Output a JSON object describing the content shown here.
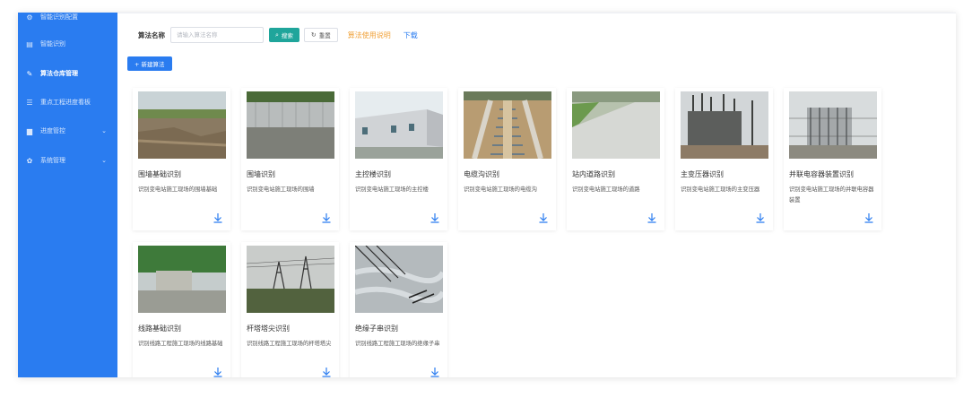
{
  "sidebar": {
    "items": [
      {
        "label": "智能识别配置",
        "icon": "settings-icon"
      },
      {
        "label": "智能识别",
        "icon": "document-icon"
      },
      {
        "label": "算法仓库管理",
        "icon": "edit-icon"
      },
      {
        "label": "重点工程进度看板",
        "icon": "list-icon"
      },
      {
        "label": "进度管控",
        "icon": "folder-icon"
      },
      {
        "label": "系统管理",
        "icon": "gear-icon"
      }
    ]
  },
  "toolbar": {
    "name_label": "算法名称",
    "search_placeholder": "请输入算法名称",
    "search_value": "",
    "search_button": "搜索",
    "reset_button": "重置",
    "guide_link": "算法使用说明",
    "download_link": "下载"
  },
  "new_button": "+ 新建算法",
  "cards": [
    {
      "title": "围墙基础识别",
      "desc": "识别变电站施工现场的围墙基础"
    },
    {
      "title": "围墙识别",
      "desc": "识别变电站施工现场的围墙"
    },
    {
      "title": "主控楼识别",
      "desc": "识别变电站施工现场的主控楼"
    },
    {
      "title": "电缆沟识别",
      "desc": "识别变电站施工现场的电缆沟"
    },
    {
      "title": "站内道路识别",
      "desc": "识别变电站施工现场的道路"
    },
    {
      "title": "主变压器识别",
      "desc": "识别变电站施工现场的主变压器"
    },
    {
      "title": "并联电容器装置识别",
      "desc": "识别变电站施工现场的并联电容器装置"
    },
    {
      "title": "线路基础识别",
      "desc": "识别线路工程施工现场的线路基础"
    },
    {
      "title": "杆塔塔尖识别",
      "desc": "识别线路工程施工现场的杆塔塔尖"
    },
    {
      "title": "绝缘子串识别",
      "desc": "识别线路工程施工现场的绝缘子串"
    }
  ],
  "colors": {
    "sidebar": "#2a7cf0",
    "search_button": "#1fa59b",
    "guide_link": "#f0a23a",
    "download_link": "#2a7cf0"
  }
}
